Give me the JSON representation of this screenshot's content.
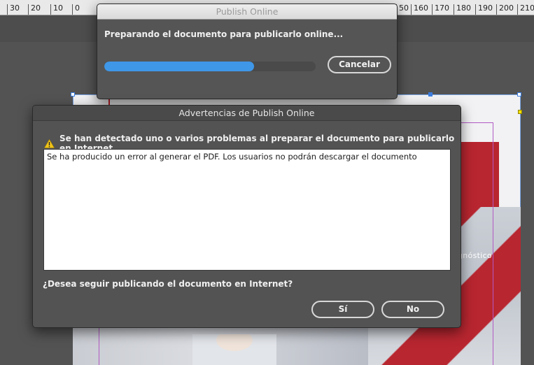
{
  "ruler": {
    "labels": [
      "30",
      "20",
      "10",
      "0",
      "50",
      "160",
      "170",
      "180",
      "190",
      "200",
      "210"
    ]
  },
  "document": {
    "visible_text": "gnóstico"
  },
  "progress_dialog": {
    "title": "Publish Online",
    "message": "Preparando el documento para publicarlo online...",
    "progress_percent": 71,
    "cancel_label": "Cancelar"
  },
  "warnings_dialog": {
    "title": "Advertencias de Publish Online",
    "warning_text": "Se han detectado uno o varios problemas al preparar el documento para publicarlo en Internet.",
    "message": "Se ha producido un error al generar el PDF. Los usuarios no podrán descargar el documento",
    "question": "¿Desea seguir publicando el documento en Internet?",
    "yes_label": "Sí",
    "no_label": "No",
    "warning_icon": "warning-triangle-icon",
    "warning_color": "#f0c419"
  }
}
